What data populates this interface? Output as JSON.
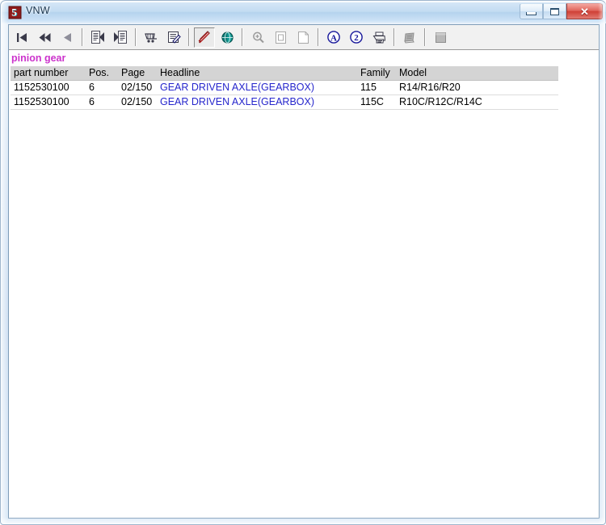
{
  "window": {
    "title": "VNW",
    "icon": "app-icon-vnw",
    "controls": {
      "minimize_label": "–",
      "maximize_label": "□",
      "close_label": "✕"
    }
  },
  "toolbar": {
    "buttons": [
      {
        "name": "first-record-button",
        "icon": "skip-to-first-icon",
        "tooltip": "First"
      },
      {
        "name": "previous-page-button",
        "icon": "rewind-icon",
        "tooltip": "Previous page"
      },
      {
        "name": "previous-record-button",
        "icon": "play-back-icon",
        "tooltip": "Previous"
      },
      {
        "name": "separator-1",
        "icon": "separator",
        "tooltip": ""
      },
      {
        "name": "document-first-button",
        "icon": "document-left-icon",
        "tooltip": "Document start"
      },
      {
        "name": "document-next-button",
        "icon": "document-right-icon",
        "tooltip": "Document next"
      },
      {
        "name": "separator-2",
        "icon": "separator",
        "tooltip": ""
      },
      {
        "name": "shopping-cart-button",
        "icon": "cart-icon",
        "tooltip": "Order basket"
      },
      {
        "name": "edit-note-button",
        "icon": "note-edit-icon",
        "tooltip": "Edit note"
      },
      {
        "name": "separator-3",
        "icon": "separator",
        "tooltip": ""
      },
      {
        "name": "annotation-pen-button",
        "icon": "pen-strike-icon",
        "tooltip": "Annotation",
        "state": "pressed"
      },
      {
        "name": "globe-button",
        "icon": "globe-icon",
        "tooltip": "Web"
      },
      {
        "name": "separator-4",
        "icon": "separator",
        "tooltip": ""
      },
      {
        "name": "zoom-button",
        "icon": "magnifier-plus-icon",
        "tooltip": "Zoom"
      },
      {
        "name": "page-view-button",
        "icon": "page-box-icon",
        "tooltip": "Page view"
      },
      {
        "name": "page-fit-button",
        "icon": "page-fold-icon",
        "tooltip": "Fit page"
      },
      {
        "name": "separator-5",
        "icon": "separator",
        "tooltip": ""
      },
      {
        "name": "search-text-button",
        "icon": "circled-a-icon",
        "tooltip": "Find text"
      },
      {
        "name": "search-next-button",
        "icon": "circled-2-icon",
        "tooltip": "Find next"
      },
      {
        "name": "print-button",
        "icon": "printer-icon",
        "tooltip": "Print"
      },
      {
        "name": "separator-6",
        "icon": "separator",
        "tooltip": ""
      },
      {
        "name": "book-button",
        "icon": "book-icon",
        "tooltip": "Catalog"
      },
      {
        "name": "separator-7",
        "icon": "separator",
        "tooltip": ""
      },
      {
        "name": "stop-button",
        "icon": "stop-square-icon",
        "tooltip": "Stop"
      }
    ]
  },
  "search": {
    "term": "pinion gear",
    "term_color": "#cc33cc"
  },
  "results": {
    "columns": [
      "part number",
      "Pos.",
      "Page",
      "Headline",
      "Family",
      "Model"
    ],
    "rows": [
      {
        "part_number": "1152530100",
        "pos": "6",
        "page": "02/150",
        "headline": "GEAR DRIVEN AXLE(GEARBOX)",
        "family": "115",
        "model": "R14/R16/R20"
      },
      {
        "part_number": "1152530100",
        "pos": "6",
        "page": "02/150",
        "headline": "GEAR DRIVEN AXLE(GEARBOX)",
        "family": "115C",
        "model": "R10C/R12C/R14C"
      }
    ],
    "link_color": "#2626cc",
    "header_background": "#d4d4d4"
  }
}
